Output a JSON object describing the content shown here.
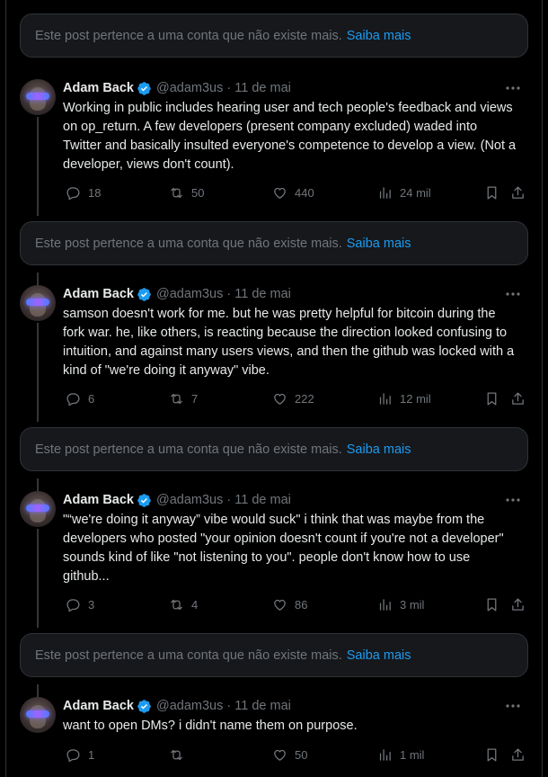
{
  "notice": {
    "text": "Este post pertence a uma conta que não existe mais.",
    "link": "Saiba mais"
  },
  "author": {
    "name": "Adam Back",
    "handle": "@adam3us",
    "verified": true
  },
  "tweets": [
    {
      "date": "11 de mai",
      "text": "Working in public includes hearing user and tech people's feedback and views on op_return. A few developers (present company excluded) waded into Twitter and basically insulted everyone's competence to develop a view. (Not a developer, views don't count).",
      "replies": "18",
      "reposts": "50",
      "likes": "440",
      "views": "24 mil"
    },
    {
      "date": "11 de mai",
      "text": "samson doesn't work for me. but he was pretty helpful for bitcoin during the fork war. he, like others, is reacting because the direction looked confusing to intuition, and against many users views, and then the github was locked with a kind of \"we're doing it anyway\" vibe.",
      "replies": "6",
      "reposts": "7",
      "likes": "222",
      "views": "12 mil"
    },
    {
      "date": "11 de mai",
      "text": "\"“we're doing it anyway” vibe would suck\" i think that was maybe from the developers who posted \"your opinion doesn't count if you're not a developer\" sounds kind of like \"not listening to you\". people don't know how to use github...",
      "replies": "3",
      "reposts": "4",
      "likes": "86",
      "views": "3 mil"
    },
    {
      "date": "11 de mai",
      "text": "want to open DMs? i didn't name them on purpose.",
      "replies": "1",
      "reposts": "",
      "likes": "50",
      "views": "1 mil"
    }
  ],
  "icons": {
    "verified_color": "#1d9bf0",
    "link_color": "#1d9bf0",
    "names": [
      "verified-icon",
      "more-icon",
      "reply-icon",
      "repost-icon",
      "like-icon",
      "views-icon",
      "bookmark-icon",
      "share-icon"
    ]
  }
}
